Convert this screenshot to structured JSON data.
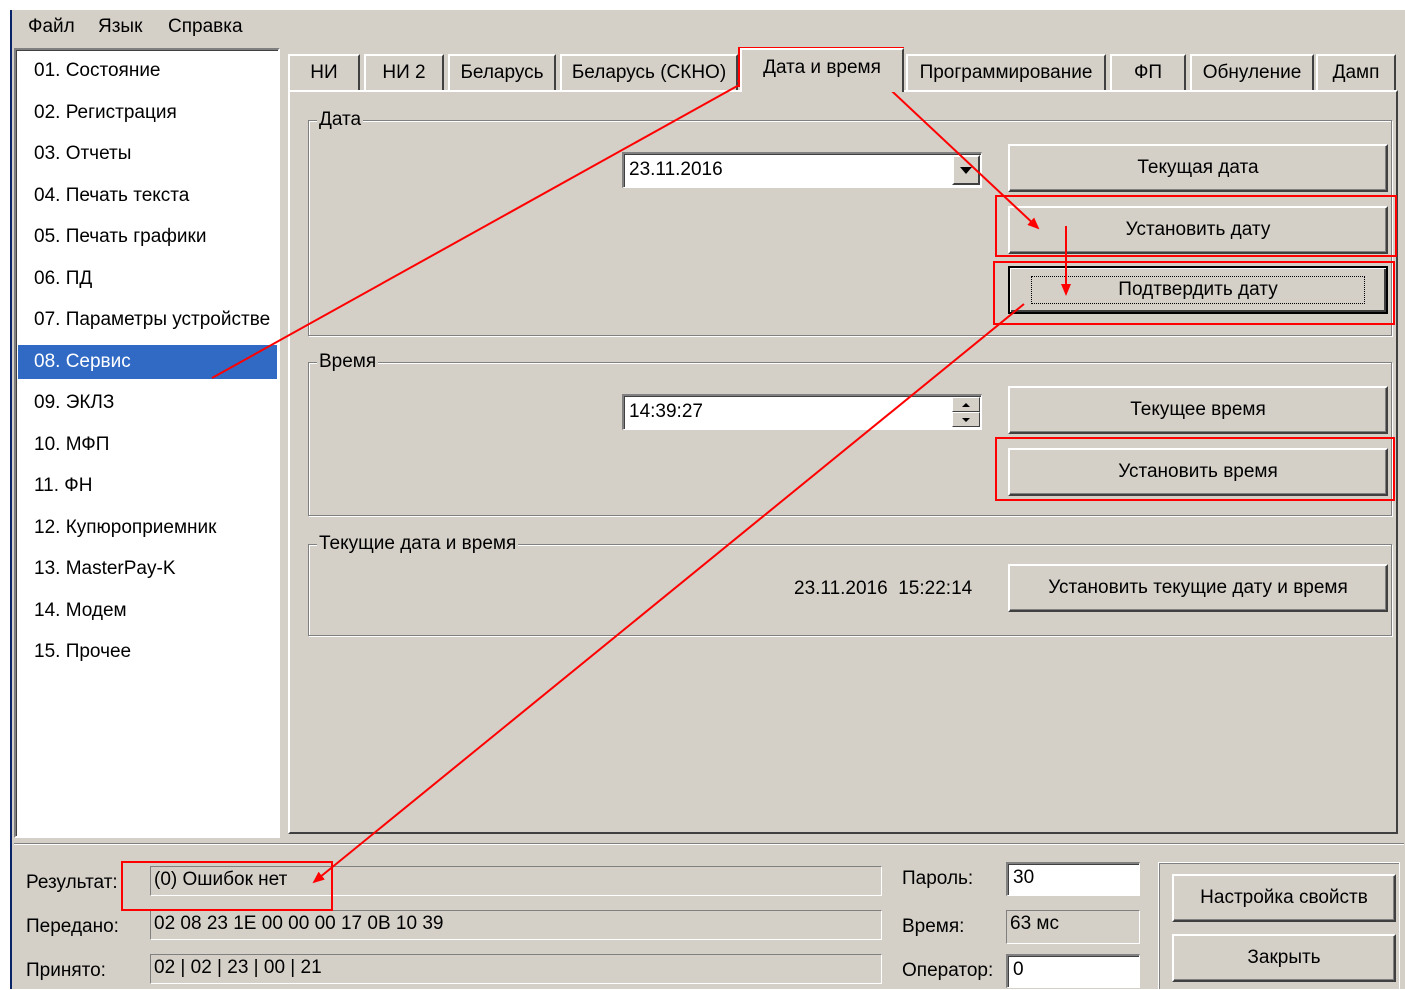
{
  "menu": [
    "Файл",
    "Язык",
    "Справка"
  ],
  "nav": {
    "items": [
      "01. Состояние",
      "02. Регистрация",
      "03. Отчеты",
      "04. Печать текста",
      "05. Печать графики",
      "06. ПД",
      "07. Параметры устройстве",
      "08. Сервис",
      "09. ЭКЛЗ",
      "10. МФП",
      "11. ФН",
      "12. Купюроприемник",
      "13. MasterPay-K",
      "14. Модем",
      "15. Прочее"
    ],
    "selected": "08. Сервис"
  },
  "tabs": [
    "НИ",
    "НИ 2",
    "Беларусь",
    "Беларусь (СКНО)",
    "Дата и время",
    "Программирование",
    "ФП",
    "Обнуление",
    "Дамп"
  ],
  "active_tab": "Дата и время",
  "date_group": {
    "title": "Дата",
    "value": "23.11.2016",
    "btn_current": "Текущая дата",
    "btn_set": "Установить дату",
    "btn_confirm": "Подтвердить дату"
  },
  "time_group": {
    "title": "Время",
    "value": "14:39:27",
    "btn_current": "Текущее время",
    "btn_set": "Установить время"
  },
  "current_group": {
    "title": "Текущие дата и время",
    "value": "23.11.2016  15:22:14",
    "btn_set": "Установить текущие дату и время"
  },
  "status": {
    "result_label": "Результат:",
    "result_value": "(0) Ошибок нет",
    "sent_label": "Передано:",
    "sent_value": "02 08 23 1E 00 00 00 17 0B 10 39",
    "received_label": "Принято:",
    "received_value": "02 | 02 | 23 | 00 | 21",
    "password_label": "Пароль:",
    "password_value": "30",
    "time_label": "Время:",
    "time_value": "63 мс",
    "operator_label": "Оператор:",
    "operator_value": "0",
    "btn_settings": "Настройка свойств",
    "btn_close": "Закрыть"
  },
  "annotation_color": "#ff0000"
}
